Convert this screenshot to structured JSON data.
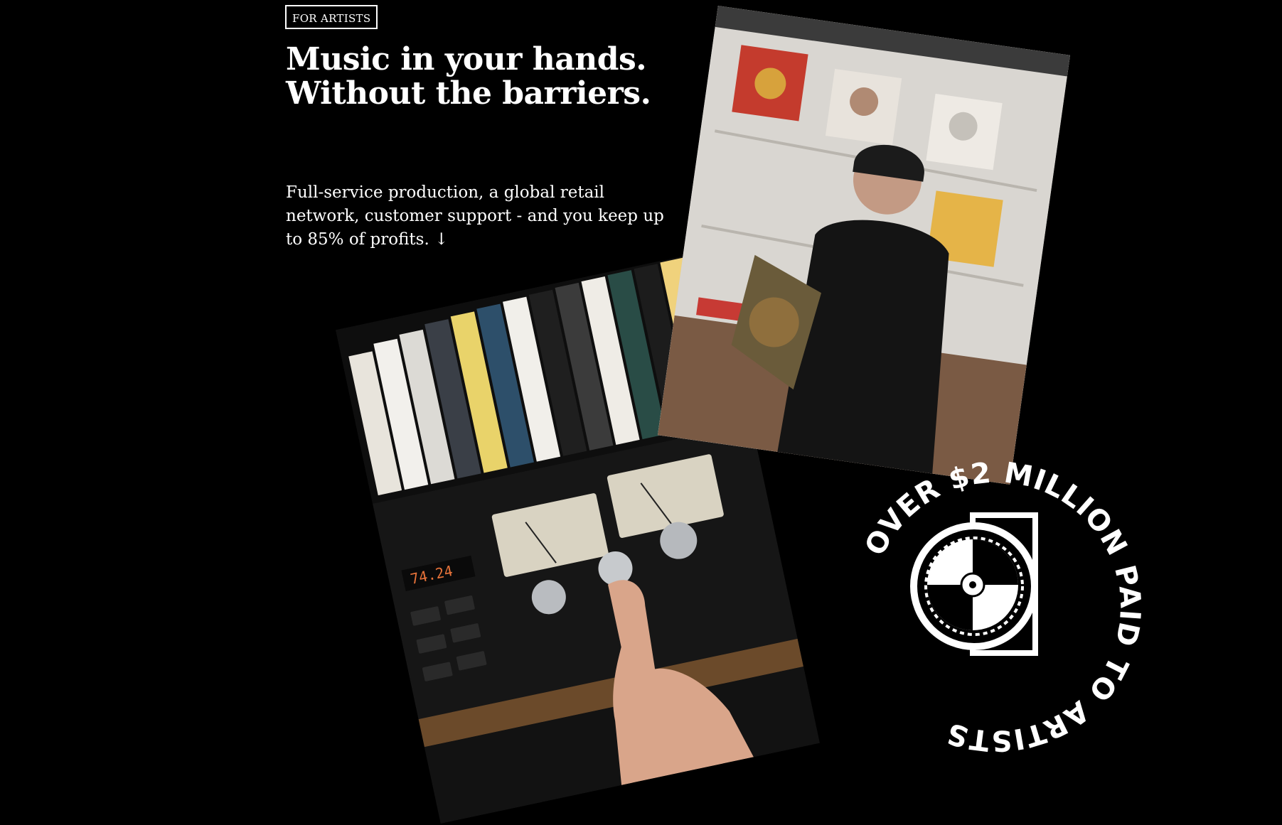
{
  "hero": {
    "badge": "FOR ARTISTS",
    "headline": "Music in your hands. Without the barriers.",
    "subcopy": "Full-service production, a global retail network, customer support - and you keep up to 85% of profits. ↓"
  },
  "images": {
    "deck_alt": "Hand adjusting a knob on a cassette deck below a shelf of cassette tapes",
    "store_alt": "Man in a beanie looking at a vinyl record in a record store"
  },
  "stamp": {
    "text": "OVER $2 MILLION PAID TO ARTISTS",
    "icon": "vinyl-record-coin-icon"
  },
  "colors": {
    "background": "#000000",
    "foreground": "#ffffff"
  }
}
